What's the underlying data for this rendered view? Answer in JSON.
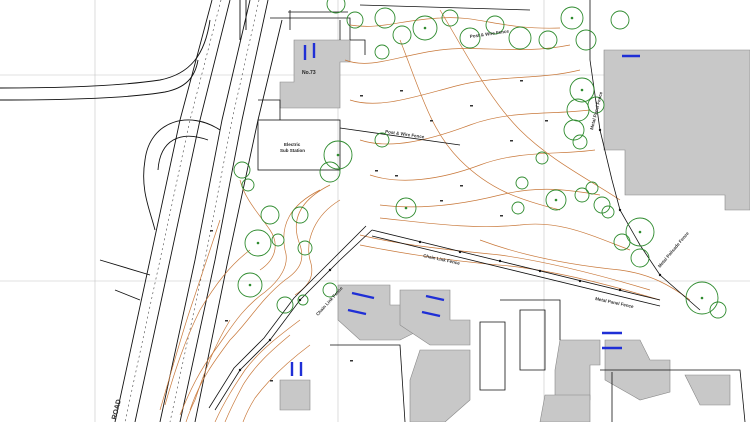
{
  "labels": {
    "building_no": "No.73",
    "substation_line1": "Electric",
    "substation_line2": "Sub Station",
    "road": "ROAD",
    "fence_a": "Post & Wire Fence",
    "fence_b": "Post & Wire Fence",
    "fence_c": "Chain Link Fence",
    "fence_d": "Chain Link Fence",
    "fence_e": "Metal Panel Fence",
    "fence_f": "Metal Panel Fence",
    "fence_g": "Metal Palisade Fence"
  },
  "colors": {
    "contour": "#c8783a",
    "tree": "#2e8b2e",
    "building": "#c8c8c8",
    "parking": "#1f2fd6",
    "linework": "#111111",
    "grid": "#bfbfbf"
  }
}
